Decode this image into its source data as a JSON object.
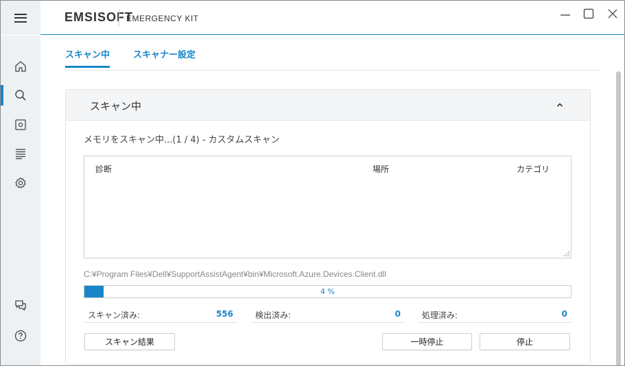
{
  "app": {
    "brand": "EMSISOFT",
    "product": "EMERGENCY KIT"
  },
  "window_controls": {
    "minimize_icon": "minimize-icon",
    "maximize_icon": "maximize-icon",
    "close_icon": "close-icon"
  },
  "sidebar": {
    "items": [
      {
        "icon": "home-icon"
      },
      {
        "icon": "search-icon",
        "active": true
      },
      {
        "icon": "quarantine-icon"
      },
      {
        "icon": "logs-icon"
      },
      {
        "icon": "settings-icon"
      },
      {
        "icon": "feedback-icon"
      },
      {
        "icon": "help-icon"
      }
    ]
  },
  "tabs": [
    {
      "label": "スキャン中",
      "active": true
    },
    {
      "label": "スキャナー設定",
      "active": false
    }
  ],
  "card": {
    "title": "スキャン中",
    "status": "メモリをスキャン中...(1 / 4) - カスタムスキャン",
    "columns": [
      "診断",
      "場所",
      "カテゴリ"
    ],
    "current_file": "C:¥Program Files¥Dell¥SupportAssistAgent¥bin¥Microsoft.Azure.Devices.Client.dll",
    "progress_value": 4,
    "progress_text": "4 %",
    "stats": [
      {
        "label": "スキャン済み:",
        "value": "556"
      },
      {
        "label": "検出済み:",
        "value": "0"
      },
      {
        "label": "処理済み:",
        "value": "0"
      }
    ],
    "buttons": {
      "results": "スキャン結果",
      "pause": "一時停止",
      "stop": "停止"
    }
  },
  "colors": {
    "accent": "#1a86c8",
    "sidebar_bg": "#eef1f4"
  }
}
